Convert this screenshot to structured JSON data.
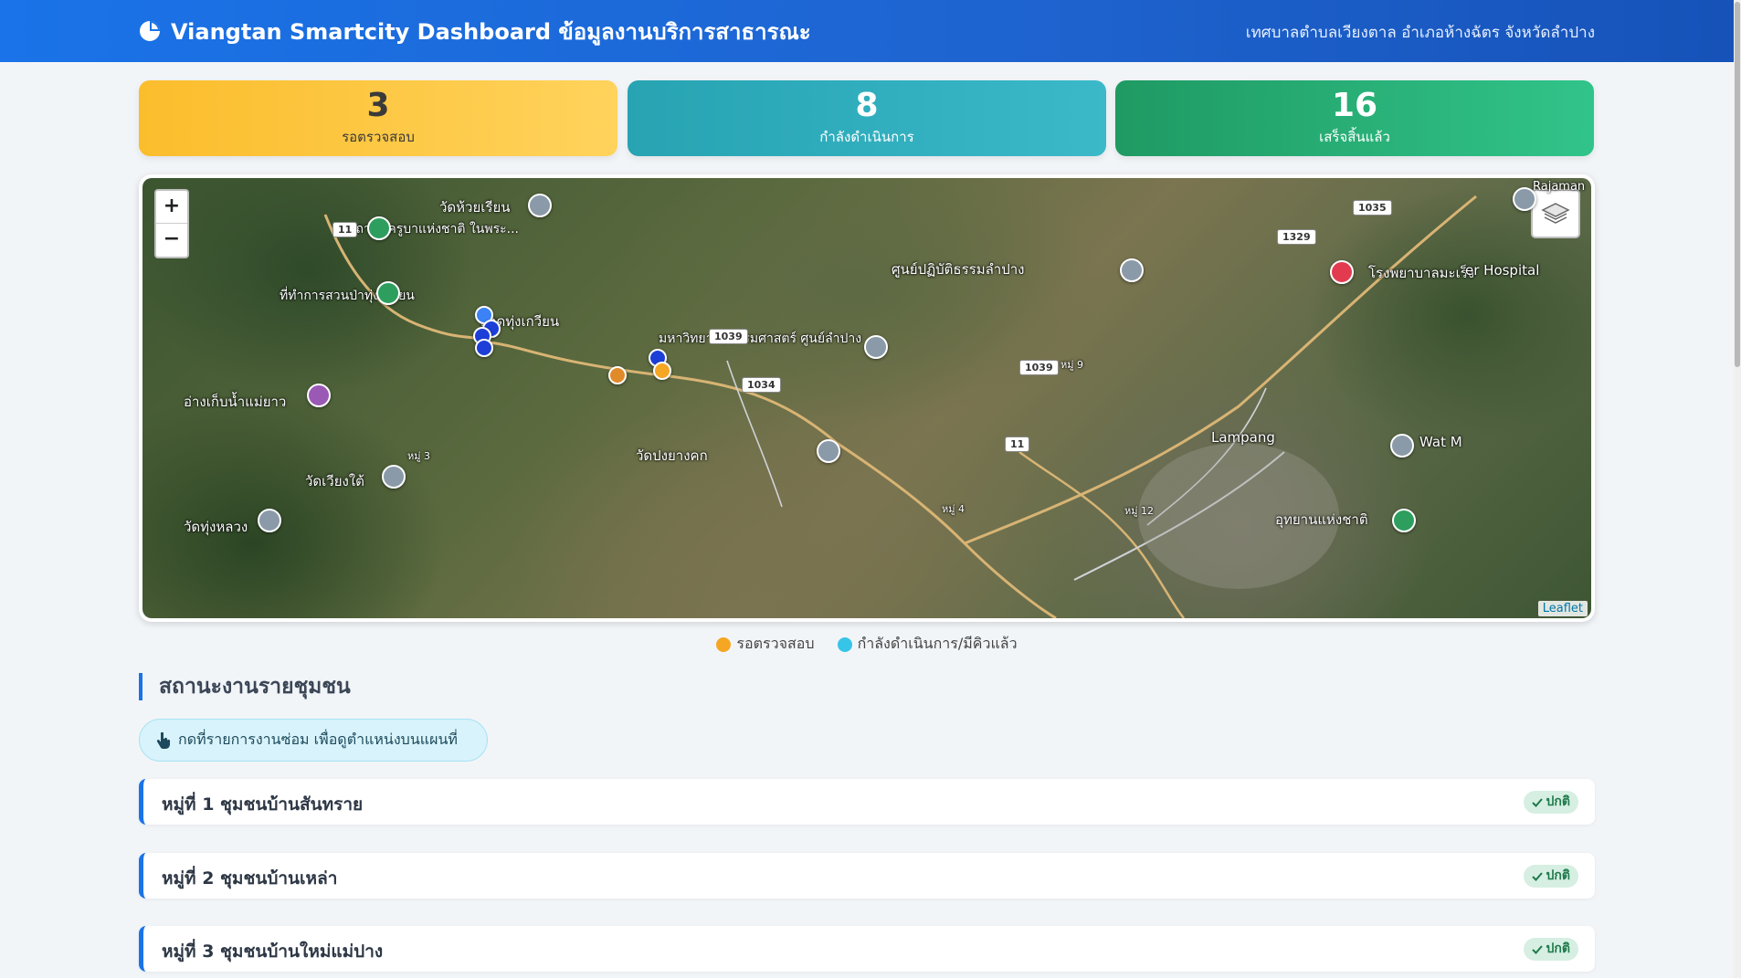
{
  "header": {
    "title": "Viangtan Smartcity Dashboard ข้อมูลงานบริการสาธารณะ",
    "subtitle": "เทศบาลตำบลเวียงตาล อำเภอห้างฉัตร จังหวัดลำปาง"
  },
  "stats": {
    "pending": {
      "value": "3",
      "label": "รอตรวจสอบ",
      "color": "#fbbd2c"
    },
    "in_progress": {
      "value": "8",
      "label": "กำลังดำเนินการ",
      "color": "#27a3b2"
    },
    "done": {
      "value": "16",
      "label": "เสร็จสิ้นแล้ว",
      "color": "#1f9a63"
    }
  },
  "map": {
    "zoom_in": "+",
    "zoom_out": "−",
    "attribution": "Leaflet",
    "places": [
      "วัดห้วยเรียน",
      "สถาบันครูบาแห่งชาติ ในพระ...",
      "ที่ทำการสวนป่าทุ่งเกวียน",
      "กาดทุ่งเกวียน",
      "อ่างเก็บน้ำแม่ยาว",
      "มหาวิทยาลัยธรรมศาสตร์ ศูนย์ลำปาง",
      "ศูนย์ปฏิบัติธรรมลำปาง",
      "โรงพยาบาลมะเร็ง",
      "วัดปงยางคก",
      "วัดเวียงใต้",
      "วัดทุ่งหลวง",
      "Lampang",
      "Wat M",
      "อุทยานแห่งชาติ",
      "Rajaman",
      "er Hospital",
      "หมู่ 3",
      "หมู่ 4",
      "หมู่ 9",
      "หมู่ 12"
    ],
    "route_shields": [
      "11",
      "1039",
      "1034",
      "1035",
      "1329"
    ]
  },
  "legend": [
    {
      "label": "รอตรวจสอบ",
      "color": "#f5a623"
    },
    {
      "label": "กำลังดำเนินการ/มีคิวแล้ว",
      "color": "#36c5e8"
    }
  ],
  "section": {
    "title": "สถานะงานรายชุมชน",
    "hint": "กดที่รายการงานซ่อม เพื่อดูตำแหน่งบนแผนที่"
  },
  "communities": [
    {
      "name": "หมู่ที่ 1 ชุมชนบ้านสันทราย",
      "status": "ปกติ"
    },
    {
      "name": "หมู่ที่ 2 ชุมชนบ้านเหล่า",
      "status": "ปกติ"
    },
    {
      "name": "หมู่ที่ 3 ชุมชนบ้านใหม่แม่ปาง",
      "status": "ปกติ"
    }
  ]
}
